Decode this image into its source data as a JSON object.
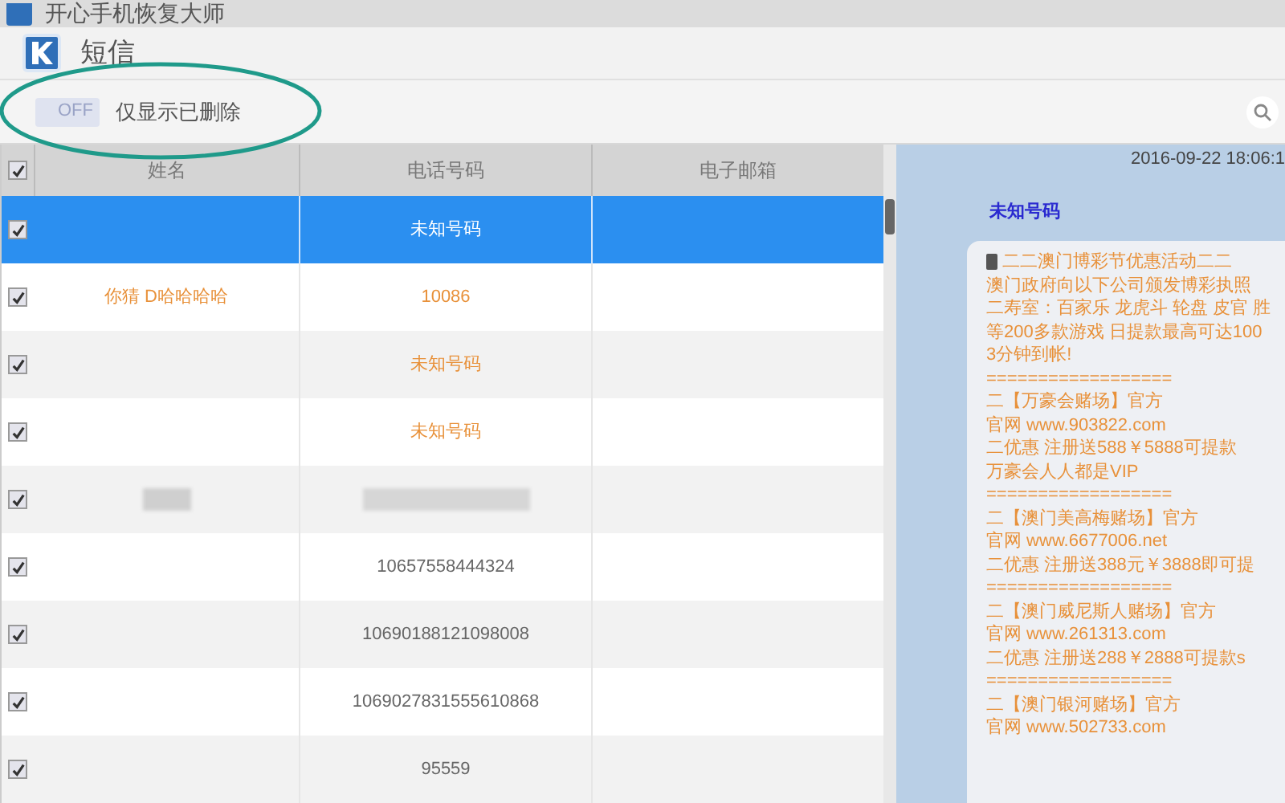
{
  "window": {
    "title": "开心手机恢复大师"
  },
  "header": {
    "title": "短信"
  },
  "toolbar": {
    "toggle": {
      "text": "OFF",
      "on": false
    },
    "label": "仅显示已删除"
  },
  "table": {
    "select_all": {
      "checked": true
    },
    "columns": [
      "姓名",
      "电话号码",
      "电子邮箱"
    ],
    "rows": [
      {
        "checked": true,
        "selected": true,
        "kind": "text",
        "name": "",
        "phone": "未知号码"
      },
      {
        "checked": true,
        "selected": false,
        "kind": "text",
        "name": "你猜 D哈哈哈哈",
        "phone": "10086",
        "color": "#e8913a"
      },
      {
        "checked": true,
        "selected": false,
        "kind": "text",
        "name": "",
        "phone": "未知号码",
        "color": "#e8913a"
      },
      {
        "checked": true,
        "selected": false,
        "kind": "text",
        "name": "",
        "phone": "未知号码",
        "color": "#e8913a"
      },
      {
        "checked": true,
        "selected": false,
        "kind": "blurred"
      },
      {
        "checked": true,
        "selected": false,
        "kind": "text",
        "name": "",
        "phone": "10657558444324",
        "color": "#666666"
      },
      {
        "checked": true,
        "selected": false,
        "kind": "text",
        "name": "",
        "phone": "10690188121098008",
        "color": "#666666"
      },
      {
        "checked": true,
        "selected": false,
        "kind": "text",
        "name": "",
        "phone": "1069027831555610868",
        "color": "#666666"
      },
      {
        "checked": true,
        "selected": false,
        "kind": "text",
        "name": "",
        "phone": "95559",
        "color": "#666666"
      }
    ]
  },
  "message": {
    "time": "2016-09-22 18:06:1",
    "sender": "未知号码",
    "lines": [
      "二二澳门博彩节优惠活动二二",
      "澳门政府向以下公司颁发博彩执照",
      "二寿室：百家乐 龙虎斗 轮盘 皮官 胜",
      "等200多款游戏 日提款最高可达100",
      "3分钟到帐!",
      "==================",
      "二【万豪会赌场】官方",
      "官网 www.903822.com",
      "二优惠 注册送588￥5888可提款",
      "万豪会人人都是VIP",
      "==================",
      "二【澳门美高梅赌场】官方",
      "官网 www.6677006.net",
      "二优惠 注册送388元￥3888即可提",
      "==================",
      "二【澳门威尼斯人赌场】官方",
      "官网 www.261313.com",
      "二优惠 注册送288￥2888可提款s",
      "==================",
      "二【澳门银河赌场】官方",
      "官网 www.502733.com"
    ]
  }
}
